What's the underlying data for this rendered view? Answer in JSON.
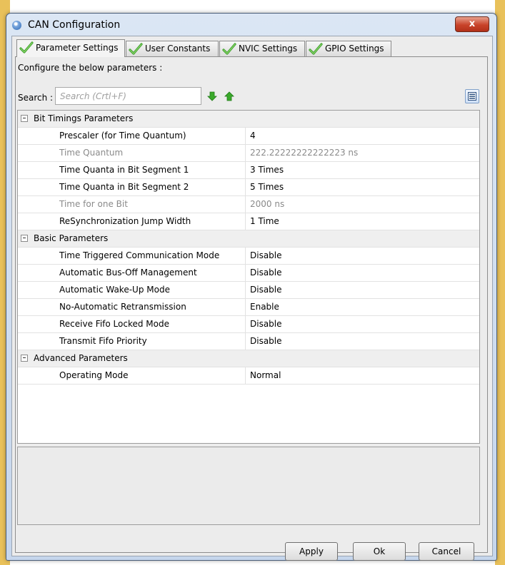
{
  "window": {
    "title": "CAN Configuration",
    "close_label": "x",
    "colors": {
      "titlebar": "#c6d6ec",
      "close_button": "#c8432a",
      "check_icon": "#4fb43a",
      "arrow_icon": "#38a82a"
    }
  },
  "tabs": [
    {
      "label": "Parameter Settings",
      "active": true,
      "icon": "check-icon"
    },
    {
      "label": "User Constants",
      "active": false,
      "icon": "check-icon"
    },
    {
      "label": "NVIC Settings",
      "active": false,
      "icon": "check-icon"
    },
    {
      "label": "GPIO Settings",
      "active": false,
      "icon": "check-icon"
    }
  ],
  "panel": {
    "instruction": "Configure the below parameters :",
    "search_label": "Search :",
    "search_placeholder": "Search (Crtl+F)",
    "search_value": "",
    "down_icon": "arrow-down-icon",
    "up_icon": "arrow-up-icon",
    "view_icon": "list-view-icon"
  },
  "groups": [
    {
      "label": "Bit Timings Parameters",
      "expanded": true,
      "params": [
        {
          "name": "Prescaler (for Time Quantum)",
          "value": "4",
          "disabled": false
        },
        {
          "name": "Time Quantum",
          "value": "222.22222222222223 ns",
          "disabled": true
        },
        {
          "name": "Time Quanta in Bit Segment 1",
          "value": "3 Times",
          "disabled": false
        },
        {
          "name": "Time Quanta in Bit Segment 2",
          "value": "5 Times",
          "disabled": false
        },
        {
          "name": "Time for one Bit",
          "value": "2000 ns",
          "disabled": true
        },
        {
          "name": "ReSynchronization Jump Width",
          "value": "1 Time",
          "disabled": false
        }
      ]
    },
    {
      "label": "Basic Parameters",
      "expanded": true,
      "params": [
        {
          "name": "Time Triggered Communication Mode",
          "value": "Disable",
          "disabled": false
        },
        {
          "name": "Automatic Bus-Off Management",
          "value": "Disable",
          "disabled": false
        },
        {
          "name": "Automatic Wake-Up Mode",
          "value": "Disable",
          "disabled": false
        },
        {
          "name": "No-Automatic Retransmission",
          "value": "Enable",
          "disabled": false
        },
        {
          "name": "Receive Fifo Locked Mode",
          "value": "Disable",
          "disabled": false
        },
        {
          "name": "Transmit Fifo Priority",
          "value": "Disable",
          "disabled": false
        }
      ]
    },
    {
      "label": "Advanced Parameters",
      "expanded": true,
      "params": [
        {
          "name": "Operating Mode",
          "value": "Normal",
          "disabled": false
        }
      ]
    }
  ],
  "footer": {
    "apply_label": "Apply",
    "ok_label": "Ok",
    "cancel_label": "Cancel"
  }
}
